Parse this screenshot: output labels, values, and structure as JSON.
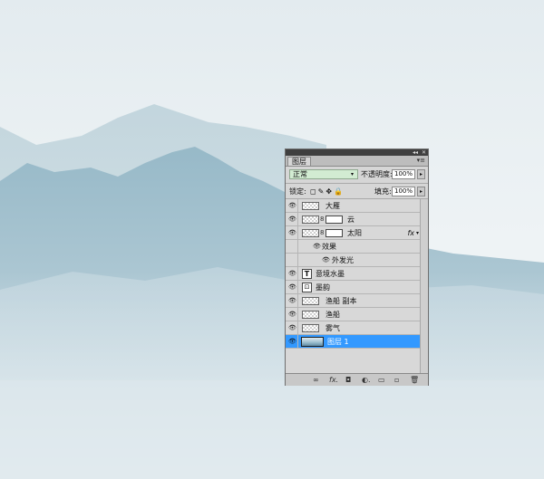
{
  "panel": {
    "tab_label": "图层",
    "collapse_icon": "double-arrow-icon",
    "close_icon": "close-icon",
    "menu_icon": "panel-menu-icon"
  },
  "blend_mode": {
    "value": "正常",
    "arrow": "▾"
  },
  "opacity": {
    "label": "不透明度:",
    "value": "100%",
    "arrow": "▸"
  },
  "lock": {
    "label": "锁定:",
    "icons": "◻✎✥🔒"
  },
  "fill": {
    "label": "填充:",
    "value": "100%",
    "arrow": "▸"
  },
  "layers": [
    {
      "name": "大雁",
      "kind": "pixel"
    },
    {
      "name": "云",
      "kind": "masked"
    },
    {
      "name": "太阳",
      "kind": "masked",
      "fx": "fx"
    },
    {
      "name": "效果",
      "kind": "effects-group"
    },
    {
      "name": "外发光",
      "kind": "effect"
    },
    {
      "name": "意境水墨",
      "kind": "text"
    },
    {
      "name": "墨韵",
      "kind": "smart"
    },
    {
      "name": "渔船 副本",
      "kind": "pixel"
    },
    {
      "name": "渔船",
      "kind": "pixel"
    },
    {
      "name": "雾气",
      "kind": "pixel"
    },
    {
      "name": "图层 1",
      "kind": "image",
      "selected": true
    }
  ],
  "bottom_bar": {
    "link": "∞",
    "fx": "fx.",
    "mask": "◘",
    "adjust": "◐.",
    "group": "▭",
    "new": "▫",
    "delete": "🗑"
  },
  "colors": {
    "selection": "#3399ff",
    "blend_bg": "#d2ecd2"
  }
}
